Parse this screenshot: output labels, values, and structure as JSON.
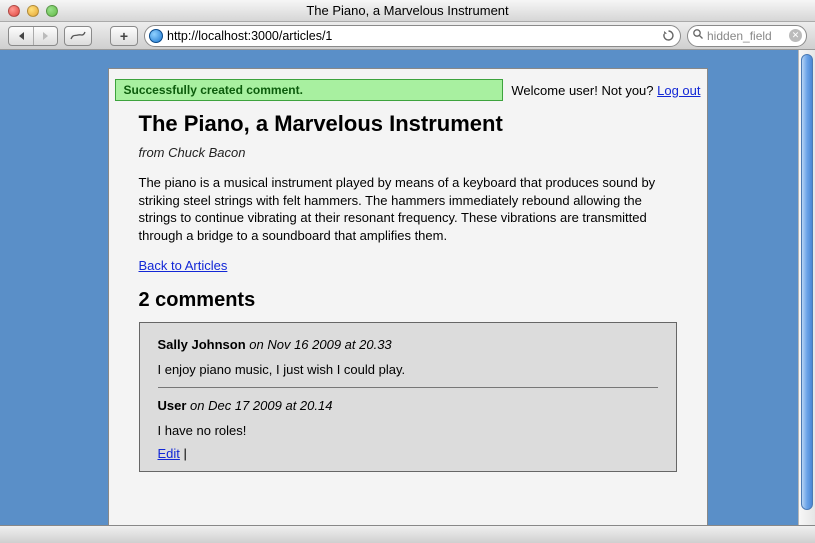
{
  "window": {
    "title": "The Piano, a Marvelous Instrument"
  },
  "toolbar": {
    "url": "http://localhost:3000/articles/1",
    "search_text": "hidden_field",
    "add_label": "+"
  },
  "flash": {
    "message": "Successfully created comment."
  },
  "userNav": {
    "welcome_prefix": "Welcome ",
    "username": "user",
    "not_you": "! Not you? ",
    "logout": "Log out"
  },
  "article": {
    "title": "The Piano, a Marvelous Instrument",
    "byline_prefix": "from ",
    "author": "Chuck Bacon",
    "body": "The piano is a musical instrument played by means of a keyboard that produces sound by striking steel strings with felt hammers. The hammers immediately rebound allowing the strings to continue vibrating at their resonant frequency. These vibrations are transmitted through a bridge to a soundboard that amplifies them.",
    "back_link": "Back to Articles"
  },
  "commentsHeader": "2 comments",
  "comments": [
    {
      "author": "Sally Johnson",
      "ts_prefix": "on ",
      "timestamp": "Nov 16 2009 at 20.33",
      "body": "I enjoy piano music, I just wish I could play."
    },
    {
      "author": "User",
      "ts_prefix": "on ",
      "timestamp": "Dec 17 2009 at 20.14",
      "body": "I have no roles!",
      "edit_label": "Edit",
      "sep": " | "
    }
  ]
}
